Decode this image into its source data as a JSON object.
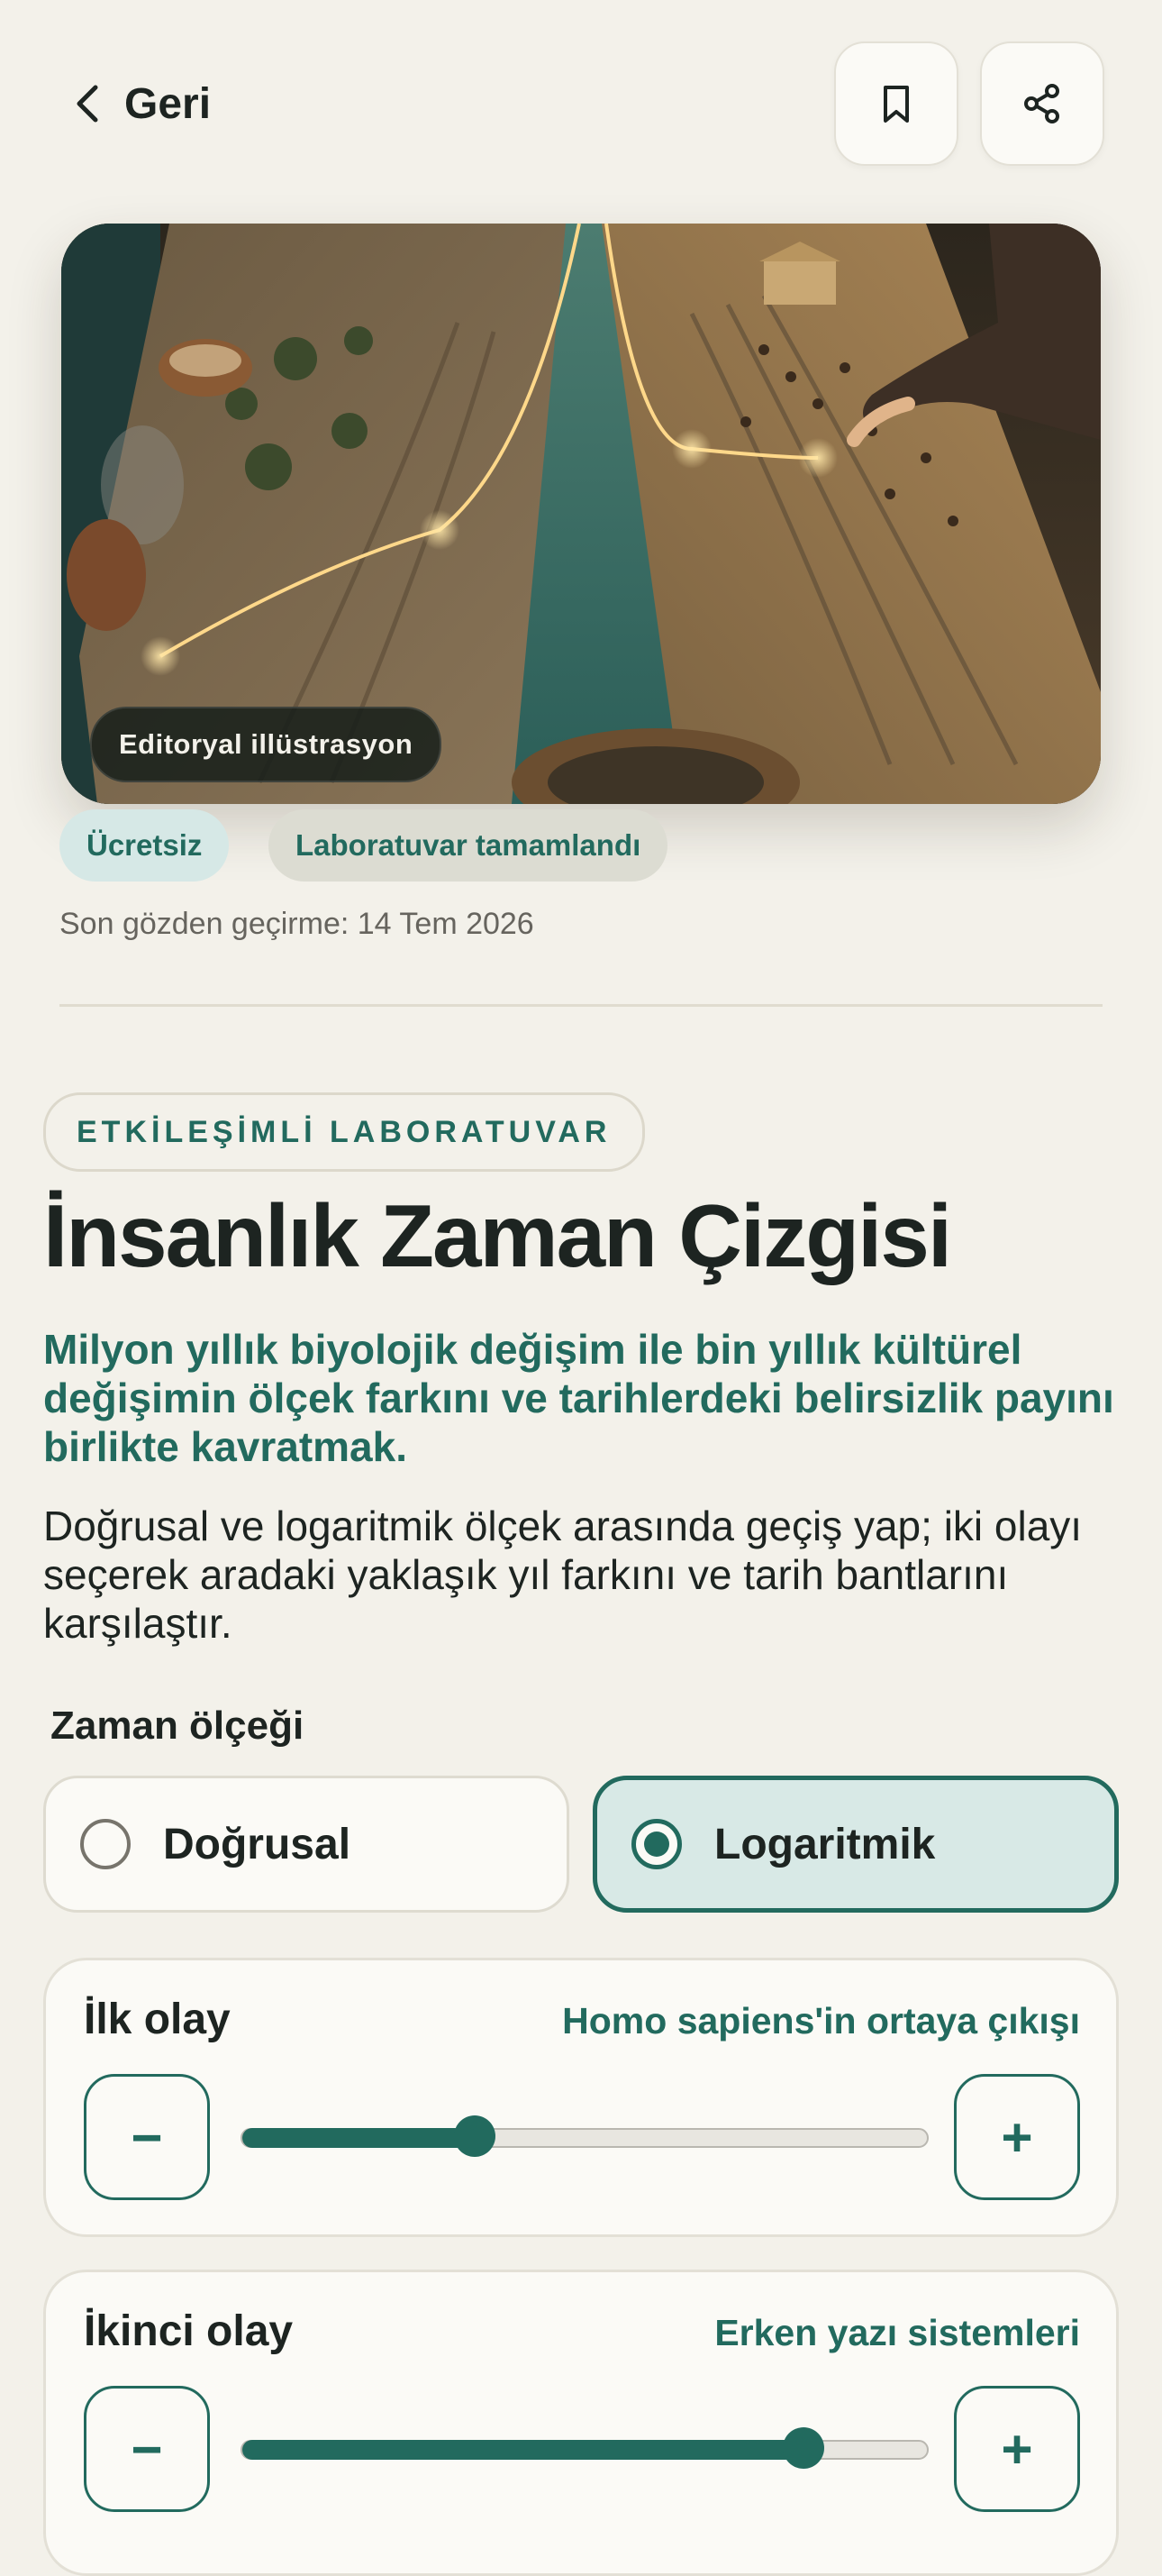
{
  "header": {
    "back_label": "Geri",
    "bookmark_icon": "bookmark-icon",
    "share_icon": "share-icon"
  },
  "hero": {
    "tag": "Editoryal illüstrasyon"
  },
  "chips": {
    "free": "Ücretsiz",
    "lab_done": "Laboratuvar tamamlandı"
  },
  "reviewed": "Son gözden geçirme: 14 Tem 2026",
  "eyebrow": "ETKİLEŞİMLİ LABORATUVAR",
  "title": "İnsanlık Zaman Çizgisi",
  "lead": "Milyon yıllık biyolojik değişim ile bin yıllık kültürel değişimin ölçek farkını ve tarihlerdeki belirsizlik payını birlikte kavratmak.",
  "description": "Doğrusal ve logaritmik ölçek arasında geçiş yap; iki olayı seçerek aradaki yaklaşık yıl farkını ve tarih bantlarını karşılaştır.",
  "scale": {
    "label": "Zaman ölçeği",
    "options": [
      {
        "label": "Doğrusal",
        "selected": false
      },
      {
        "label": "Logaritmik",
        "selected": true
      }
    ]
  },
  "events": [
    {
      "heading": "İlk olay",
      "value": "Homo sapiens'in ortaya çıkışı",
      "slider_fraction": 0.34,
      "minus": "−",
      "plus": "+"
    },
    {
      "heading": "İkinci olay",
      "value": "Erken yazı sistemleri",
      "slider_fraction": 0.82,
      "minus": "−",
      "plus": "+"
    }
  ],
  "colors": {
    "accent": "#226a5e",
    "accent_soft": "#d8e9e6",
    "background": "#f3f1ea",
    "text": "#1d2421"
  }
}
